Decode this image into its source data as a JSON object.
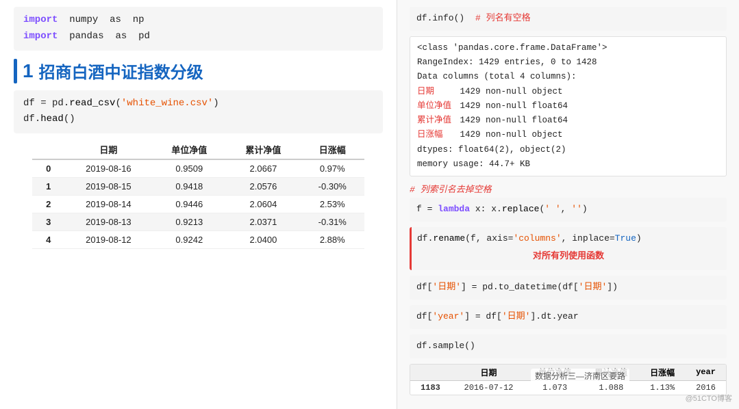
{
  "left": {
    "code1_line1_kw1": "import",
    "code1_line1_lib": "numpy",
    "code1_line1_as": "as",
    "code1_line1_alias": "np",
    "code1_line2_kw1": "import",
    "code1_line2_lib": "pandas",
    "code1_line2_as": "as",
    "code1_line2_alias": "pd",
    "section_num": "1",
    "section_title": "招商白酒中证指数分级",
    "code2_line1": "df = pd.read_csv('white_wine.csv')",
    "code2_line2": "df.head()",
    "table": {
      "headers": [
        "",
        "日期",
        "单位净值",
        "累计净值",
        "日涨幅"
      ],
      "rows": [
        [
          "0",
          "2019-08-16",
          "0.9509",
          "2.0667",
          "0.97%"
        ],
        [
          "1",
          "2019-08-15",
          "0.9418",
          "2.0576",
          "-0.30%"
        ],
        [
          "2",
          "2019-08-14",
          "0.9446",
          "2.0604",
          "2.53%"
        ],
        [
          "3",
          "2019-08-13",
          "0.9213",
          "2.0371",
          "-0.31%"
        ],
        [
          "4",
          "2019-08-12",
          "0.9242",
          "2.0400",
          "2.88%"
        ]
      ]
    }
  },
  "right": {
    "line1_code": "df.info()",
    "line1_comment": "# 列名有空格",
    "info_output": {
      "line1": "<class 'pandas.core.frame.DataFrame'>",
      "line2": "RangeIndex: 1429 entries, 0 to 1428",
      "line3": "Data columns (total 4 columns):",
      "line4_col": "日期",
      "line4_rest": "   1429 non-null object",
      "line5_col": " 单位净值",
      "line5_rest": "  1429 non-null float64",
      "line6_col": " 累计净值",
      "line6_rest": "  1429 non-null float64",
      "line7_col": " 日涨幅",
      "line7_rest": "   1429 non-null object",
      "line8": "dtypes: float64(2), object(2)",
      "line9": "memory usage: 44.7+ KB"
    },
    "comment2": "# 列索引名去掉空格",
    "code2": "f = lambda x: x.replace(' ', '')",
    "code3_pre": "df.rename(f, axis=",
    "code3_str": "'columns'",
    "code3_post": ", inplace=True)",
    "apply_note": "对所有列使用函数",
    "code4": "df['日期'] = pd.to_datetime(df['日期'])",
    "code5_pre": "df[",
    "code5_str1": "'year'",
    "code5_mid": "] = df[",
    "code5_str2": "'日期'",
    "code5_post": "].dt.year",
    "code6": "df.sample()",
    "bottom_table": {
      "headers": [
        "日期",
        "单位净值",
        "累计净值",
        "日涨幅",
        "year"
      ],
      "rows": [
        [
          "1183",
          "2016-07-12",
          "1.073",
          "1.088",
          "1.13%",
          "2016"
        ]
      ]
    },
    "overlay": "数据分析三—济南区要路",
    "watermark": "@51CTO博客"
  }
}
